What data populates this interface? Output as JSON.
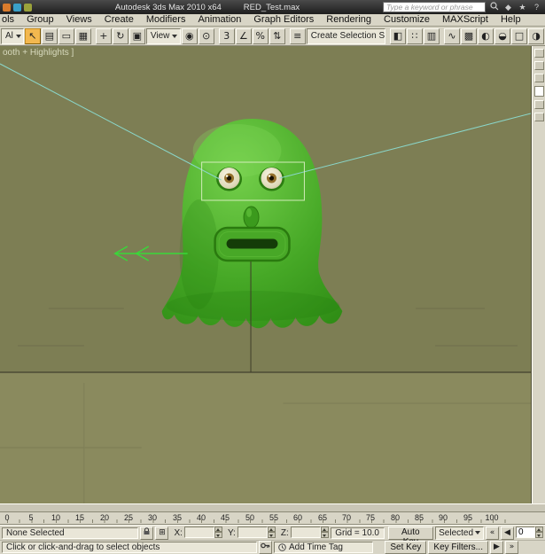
{
  "titlebar": {
    "app_title": "Autodesk 3ds Max 2010 x64",
    "document_title": "RED_Test.max",
    "search_placeholder": "Type a keyword or phrase"
  },
  "menubar": {
    "items": [
      "ols",
      "Group",
      "Views",
      "Create",
      "Modifiers",
      "Animation",
      "Graph Editors",
      "Rendering",
      "Customize",
      "MAXScript",
      "Help"
    ]
  },
  "toolbar": {
    "selection_filter": "Al",
    "coordinate_system": "View",
    "named_selection_sets": "Create Selection Se",
    "tools": [
      {
        "name": "select-object",
        "glyph": "↖"
      },
      {
        "name": "select-by-name",
        "glyph": "▤"
      },
      {
        "name": "rectangular-selection-region",
        "glyph": "▭"
      },
      {
        "name": "window-crossing",
        "glyph": "▦"
      },
      {
        "name": "select-and-move",
        "glyph": "+"
      },
      {
        "name": "select-and-rotate",
        "glyph": "↻"
      },
      {
        "name": "select-and-scale",
        "glyph": "▣"
      },
      {
        "name": "use-pivot-point-center",
        "glyph": "◉"
      },
      {
        "name": "select-and-manipulate",
        "glyph": "⊙"
      },
      {
        "name": "snaps-toggle",
        "glyph": "3"
      },
      {
        "name": "angle-snap",
        "glyph": "∠"
      },
      {
        "name": "percent-snap",
        "glyph": "%"
      },
      {
        "name": "spinner-snap",
        "glyph": "⇅"
      },
      {
        "name": "edit-named-selection-sets",
        "glyph": "≡"
      },
      {
        "name": "mirror",
        "glyph": "◧"
      },
      {
        "name": "align",
        "glyph": "∷"
      },
      {
        "name": "layer-manager",
        "glyph": "▥"
      },
      {
        "name": "curve-editor",
        "glyph": "∿"
      },
      {
        "name": "schematic-view",
        "glyph": "▩"
      },
      {
        "name": "material-editor",
        "glyph": "◐"
      },
      {
        "name": "render-setup",
        "glyph": "◒"
      },
      {
        "name": "rendered-frame-window",
        "glyph": "□"
      },
      {
        "name": "render-production",
        "glyph": "◑"
      }
    ]
  },
  "viewport": {
    "label": "ooth + Highlights ]"
  },
  "timeline": {
    "start": 0,
    "end": 100,
    "labels": [
      "0",
      "5",
      "10",
      "15",
      "20",
      "25",
      "30",
      "35",
      "40",
      "45",
      "50",
      "55",
      "60",
      "65",
      "70",
      "75",
      "80",
      "85",
      "90",
      "95",
      "100"
    ]
  },
  "status": {
    "selection": "None Selected",
    "prompt": "Click or click-and-drag to select objects",
    "x_label": "X:",
    "y_label": "Y:",
    "z_label": "Z:",
    "x_value": "",
    "y_value": "",
    "z_value": "",
    "grid": "Grid = 10.0",
    "add_time_tag": "Add Time Tag",
    "auto_key": "Auto Key",
    "set_key": "Set Key",
    "key_mode": "Selected",
    "key_filters": "Key Filters...",
    "current_frame": "0"
  },
  "icons": {
    "caret": "▼",
    "communication": "◆",
    "favorites": "★",
    "help": "?",
    "rewind": "«",
    "step_back": "◀",
    "step_forward": "▶",
    "fast_forward": "»",
    "abs_offset": "⊞"
  },
  "colors": {
    "viewport_bg": "#7d7e54",
    "model_green": "#46a826",
    "ui_beige": "#d8d5c6",
    "select_highlight": "#f3b84f"
  }
}
